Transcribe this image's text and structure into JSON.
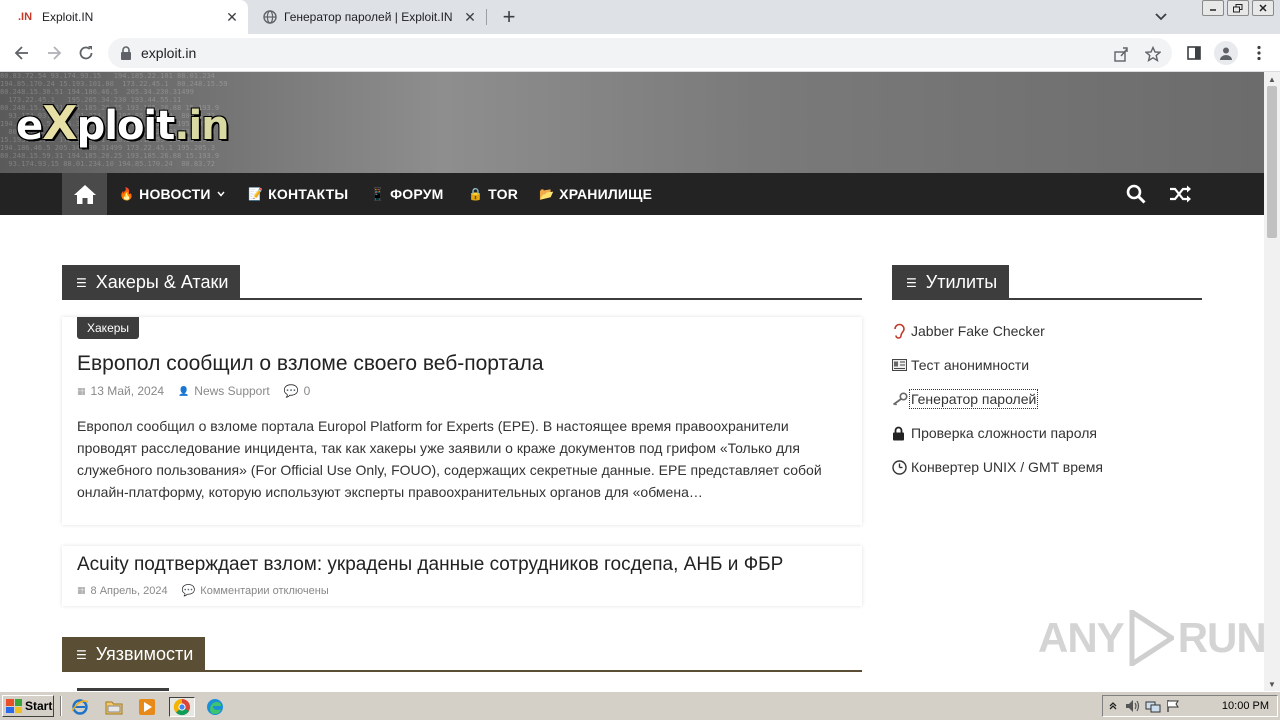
{
  "browser": {
    "tabs": [
      {
        "favicon_text": ".IN",
        "title": "Exploit.IN",
        "active": true
      },
      {
        "title": "Генератор паролей | Exploit.IN",
        "active": false
      }
    ],
    "url": "exploit.in"
  },
  "site": {
    "logo": {
      "pre": "e",
      "x": "X",
      "mid": "ploit",
      "suffix": ".in"
    },
    "nav": [
      {
        "icon": "fire-icon",
        "emoji": "🔥",
        "label": "НОВОСТИ",
        "dropdown": true
      },
      {
        "icon": "memo-icon",
        "emoji": "📝",
        "label": "КОНТАКТЫ"
      },
      {
        "icon": "phone-icon",
        "emoji": "📱",
        "label": "ФОРУМ"
      },
      {
        "icon": "lock-icon",
        "emoji": "🔒",
        "label": "TOR"
      },
      {
        "icon": "folder-icon",
        "emoji": "📂",
        "label": "ХРАНИЛИЩЕ"
      }
    ]
  },
  "sections": {
    "hackers": {
      "title": "Хакеры & Атаки"
    },
    "vulns": {
      "title": "Уязвимости"
    },
    "utils": {
      "title": "Утилиты"
    }
  },
  "posts": [
    {
      "category": "Хакеры",
      "title": "Европол сообщил о взломе своего веб-портала",
      "date": "13 Май, 2024",
      "author": "News Support",
      "comments": "0",
      "excerpt": "Европол сообщил о взломе портала Europol Platform for Experts (EPE). В настоящее время правоохранители проводят расследование инцидента, так как хакеры уже заявили о краже документов под грифом «Только для служебного пользования» (For Official Use Only, FOUO), содержащих секретные данные. EPE представляет собой онлайн-платформу, которую используют эксперты правоохранительных органов для «обмена…"
    },
    {
      "title": "Acuity подтверждает взлом: украдены данные сотрудников госдепа, АНБ и ФБР",
      "date": "8 Апрель, 2024",
      "comments": "Комментарии отключены"
    }
  ],
  "utilities": [
    {
      "icon": "ear-icon",
      "label": "Jabber Fake Checker"
    },
    {
      "icon": "id-card-icon",
      "label": "Тест анонимности"
    },
    {
      "icon": "key-icon",
      "label": "Генератор паролей"
    },
    {
      "icon": "lock-icon",
      "label": "Проверка сложности пароля"
    },
    {
      "icon": "clock-icon",
      "label": "Конвертер UNIX / GMT время"
    }
  ],
  "watermark": {
    "left": "ANY",
    "right": "RUN"
  },
  "taskbar": {
    "start_label": "Start",
    "clock": "10:00 PM"
  }
}
